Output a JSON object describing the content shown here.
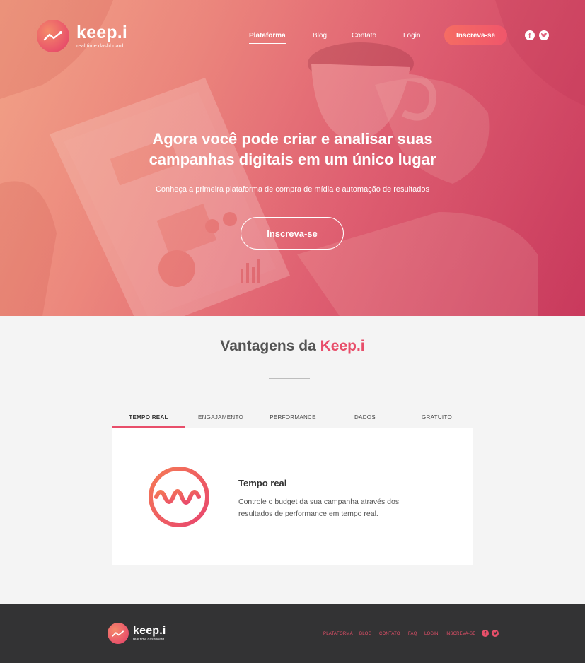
{
  "brand": {
    "name": "keep.i",
    "tagline": "real time dashboard"
  },
  "nav": {
    "items": [
      "Plataforma",
      "Blog",
      "Contato",
      "Login"
    ],
    "signup": "Inscreva-se"
  },
  "hero": {
    "title_line1": "Agora você pode criar e analisar suas",
    "title_line2": "campanhas digitais em um único lugar",
    "subtitle": "Conheça a primeira plataforma de compra de mídia e automação de resultados",
    "cta": "Inscreva-se"
  },
  "advantages": {
    "title_prefix": "Vantagens da",
    "title_brand": "Keep.i",
    "tabs": [
      "TEMPO REAL",
      "ENGAJAMENTO",
      "PERFORMANCE",
      "DADOS",
      "GRATUITO"
    ],
    "active_tab": 0,
    "panel": {
      "title": "Tempo real",
      "text": "Controle o budget da sua campanha através dos resultados de performance em tempo real."
    }
  },
  "footer": {
    "links": [
      "PLATAFORMA",
      "BLOG",
      "CONTATO",
      "FAQ",
      "LOGIN",
      "INSCREVA-SE"
    ]
  },
  "icons": [
    "trend-logo-icon",
    "facebook-icon",
    "twitter-icon",
    "realtime-wave-icon"
  ],
  "colors": {
    "accent": "#e84e6a",
    "accent_orange": "#f56c63",
    "footer_bg": "#333334",
    "page_bg": "#f4f4f4"
  }
}
